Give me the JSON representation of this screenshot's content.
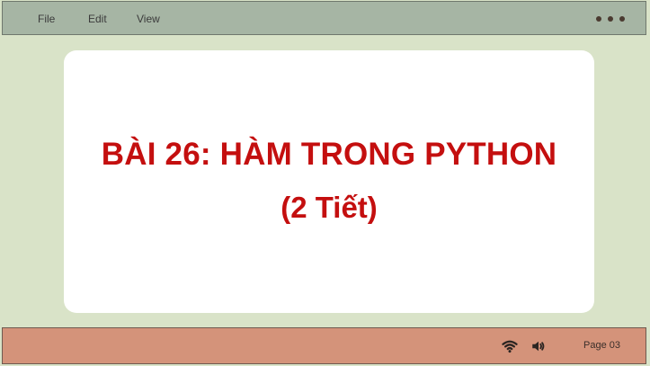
{
  "menu": {
    "file": "File",
    "edit": "Edit",
    "view": "View"
  },
  "window": {
    "more_icon": "more-dots-icon"
  },
  "slide": {
    "title": "BÀI 26: HÀM TRONG PYTHON",
    "subtitle": "(2 Tiết)"
  },
  "status": {
    "wifi_icon": "wifi-icon",
    "sound_icon": "speaker-icon",
    "page": "Page 03"
  },
  "colors": {
    "background": "#d9e3c8",
    "topbar": "#a6b5a4",
    "bottombar": "#d4937a",
    "accent": "#c40f0f"
  }
}
